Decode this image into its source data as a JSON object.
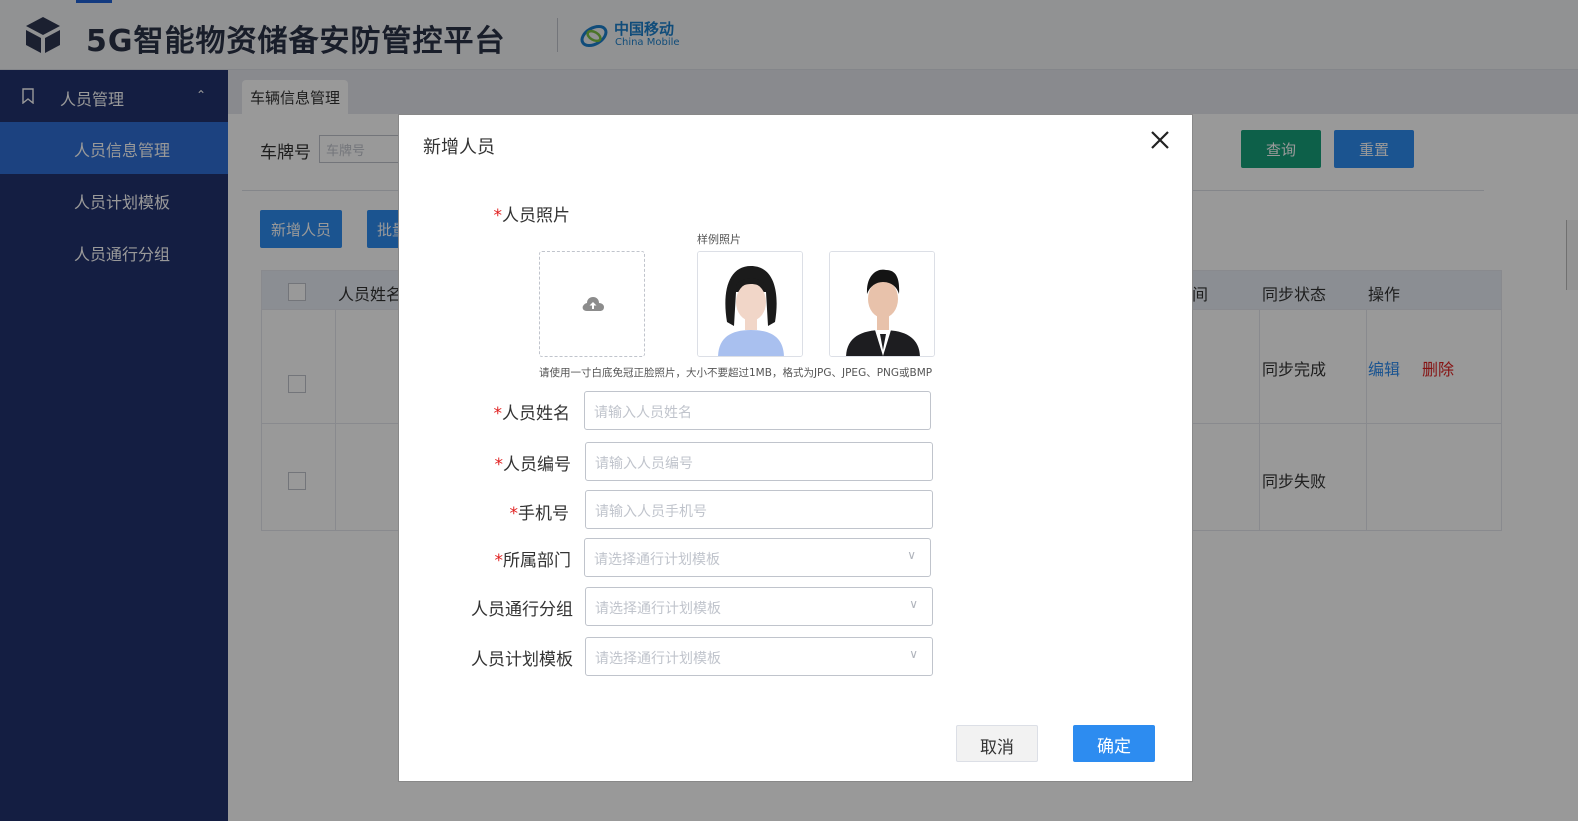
{
  "header": {
    "app_title": "5G智能物资储备安防管控平台",
    "brand_cn": "中国移动",
    "brand_en": "China Mobile"
  },
  "sidebar": {
    "group_label": "人员管理",
    "items": [
      {
        "label": "人员信息管理",
        "active": true
      },
      {
        "label": "人员计划模板",
        "active": false
      },
      {
        "label": "人员通行分组",
        "active": false
      }
    ]
  },
  "main": {
    "tab_label": "车辆信息管理",
    "filter": {
      "label": "车牌号",
      "placeholder": "车牌号"
    },
    "query_button": "查询",
    "reset_button": "重置",
    "add_button": "新增人员",
    "batch_button": "批量",
    "table": {
      "headers": {
        "name": "人员姓名",
        "time": "间",
        "sync": "同步状态",
        "action": "操作"
      },
      "rows": [
        {
          "sync": "同步完成",
          "edit": "编辑",
          "delete": "删除"
        },
        {
          "sync": "同步失败"
        }
      ]
    }
  },
  "modal": {
    "title": "新增人员",
    "photo_label": "人员照片",
    "sample_label": "样例照片",
    "hint": "请使用一寸白底免冠正脸照片，大小不要超过1MB，格式为JPG、JPEG、PNG或BMP",
    "fields": {
      "name": {
        "label": "人员姓名",
        "placeholder": "请输入人员姓名"
      },
      "number": {
        "label": "人员编号",
        "placeholder": "请输入人员编号"
      },
      "phone": {
        "label": "手机号",
        "placeholder": "请输入人员手机号"
      },
      "department": {
        "label": "所属部门",
        "placeholder": "请选择通行计划模板"
      },
      "group": {
        "label": "人员通行分组",
        "placeholder": "请选择通行计划模板"
      },
      "template": {
        "label": "人员计划模板",
        "placeholder": "请选择通行计划模板"
      }
    },
    "required_mark": "*",
    "cancel_button": "取消",
    "ok_button": "确定"
  }
}
